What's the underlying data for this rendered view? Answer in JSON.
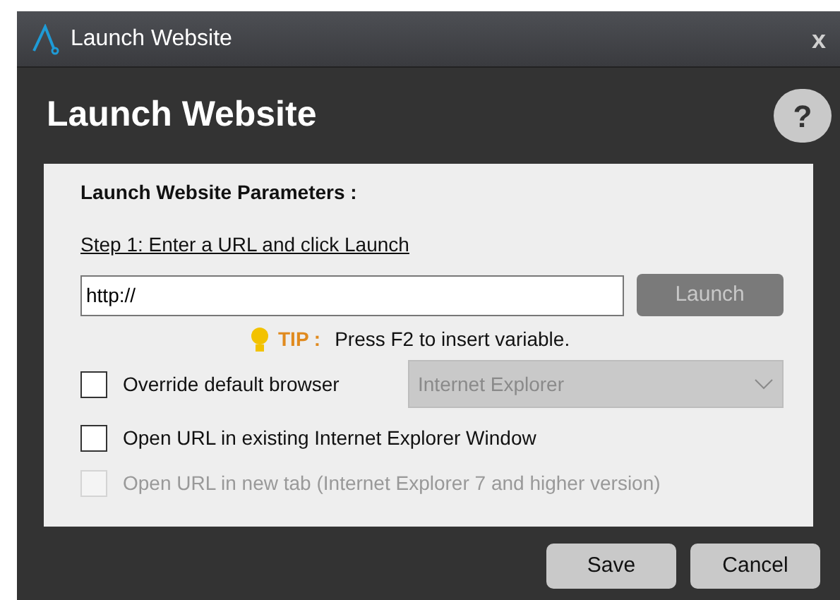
{
  "window": {
    "title": "Launch Website",
    "close": "x"
  },
  "header": {
    "title": "Launch Website",
    "help": "?"
  },
  "panel": {
    "title": "Launch Website Parameters :",
    "step": "Step 1: Enter a URL and click Launch",
    "url": {
      "value": "http://"
    },
    "launch": {
      "label": "Launch",
      "disabled": true
    },
    "tip": {
      "label": "TIP :",
      "text": "Press F2 to insert variable."
    },
    "options": [
      {
        "kind": "select",
        "label": "Override default browser",
        "checked": false,
        "disabled": false,
        "select": {
          "value": "Internet Explorer",
          "disabled": true
        }
      },
      {
        "kind": "checkbox",
        "label": "Open URL in existing Internet Explorer Window",
        "checked": false,
        "disabled": false
      },
      {
        "kind": "checkbox",
        "label": "Open URL in new tab (Internet Explorer 7 and higher version)",
        "checked": false,
        "disabled": true
      }
    ]
  },
  "buttons": [
    "Save",
    "Cancel"
  ]
}
